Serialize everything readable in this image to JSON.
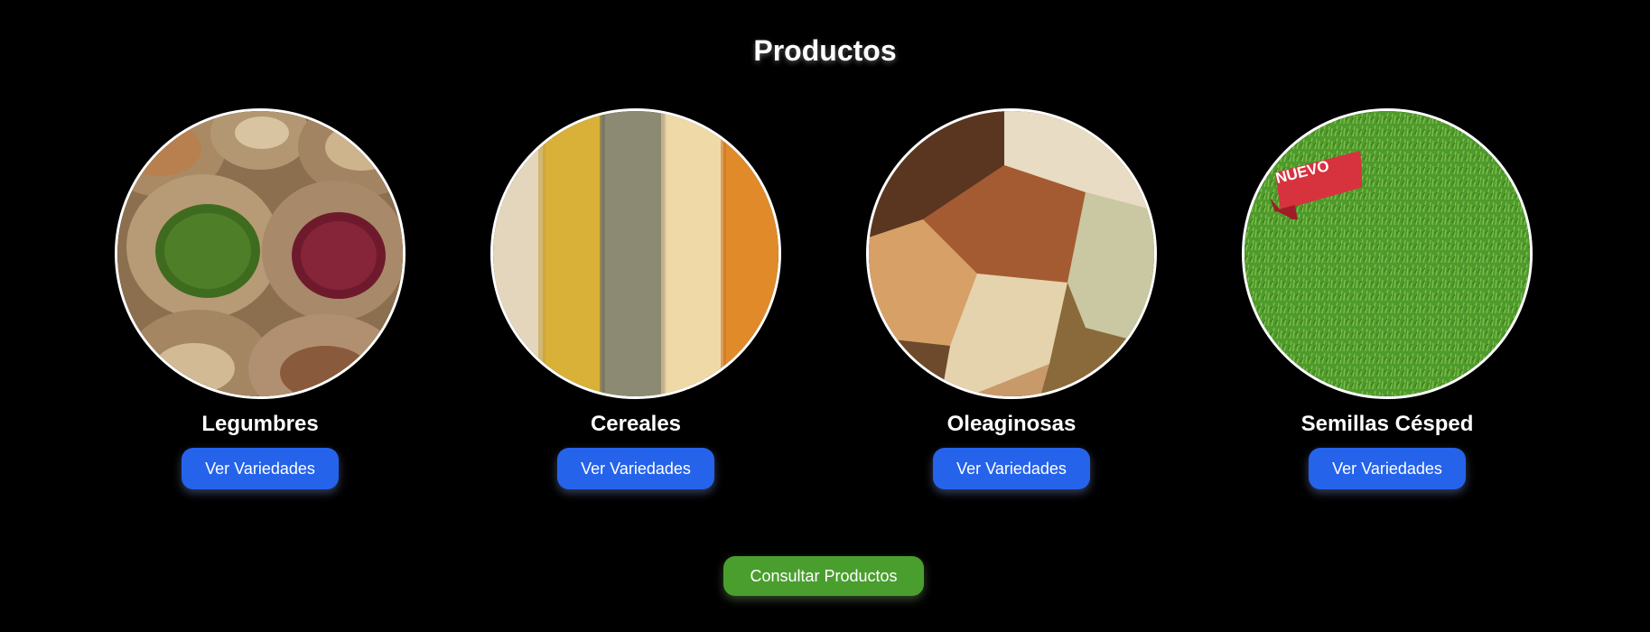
{
  "header": {
    "title": "Productos"
  },
  "products": [
    {
      "name": "Legumbres",
      "button_label": "Ver Variedades"
    },
    {
      "name": "Cereales",
      "button_label": "Ver Variedades"
    },
    {
      "name": "Oleaginosas",
      "button_label": "Ver Variedades"
    },
    {
      "name": "Semillas Césped",
      "button_label": "Ver Variedades",
      "badge": "NUEVO"
    }
  ],
  "footer": {
    "cta_label": "Consultar Productos"
  },
  "colors": {
    "background": "#000000",
    "primary_button": "#2563eb",
    "cta_button": "#4a9e2e",
    "badge": "#d7333f"
  }
}
